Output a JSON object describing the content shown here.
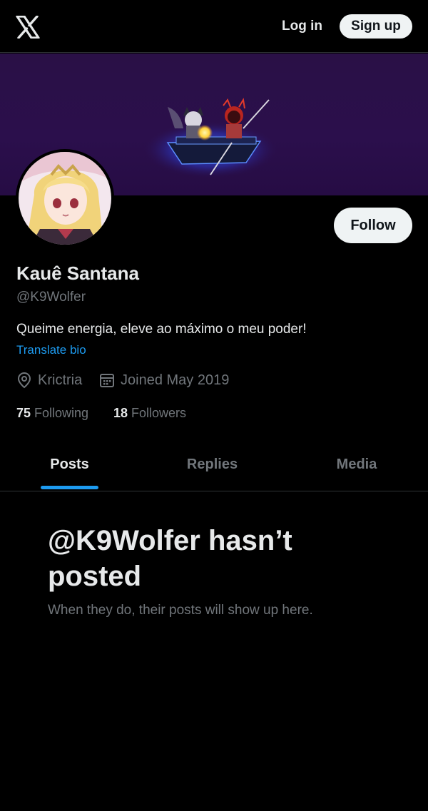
{
  "header": {
    "logo_icon": "x-logo-icon",
    "login_label": "Log in",
    "signup_label": "Sign up"
  },
  "profile": {
    "name": "Kauê Santana",
    "handle": "@K9Wolfer",
    "bio": "Queime energia, eleve ao máximo o meu poder!",
    "translate_label": "Translate bio",
    "location": "Krictria",
    "joined": "Joined May 2019",
    "following_count": "75",
    "following_label": "Following",
    "followers_count": "18",
    "followers_label": "Followers",
    "follow_label": "Follow"
  },
  "tabs": [
    {
      "label": "Posts",
      "active": true
    },
    {
      "label": "Replies",
      "active": false
    },
    {
      "label": "Media",
      "active": false
    }
  ],
  "empty_state": {
    "title": "@K9Wolfer hasn’t posted",
    "subtitle": "When they do, their posts will show up here."
  },
  "colors": {
    "background": "#000000",
    "accent": "#1d9bf0",
    "banner": "#2b0f4c",
    "muted_text": "#71767b"
  }
}
